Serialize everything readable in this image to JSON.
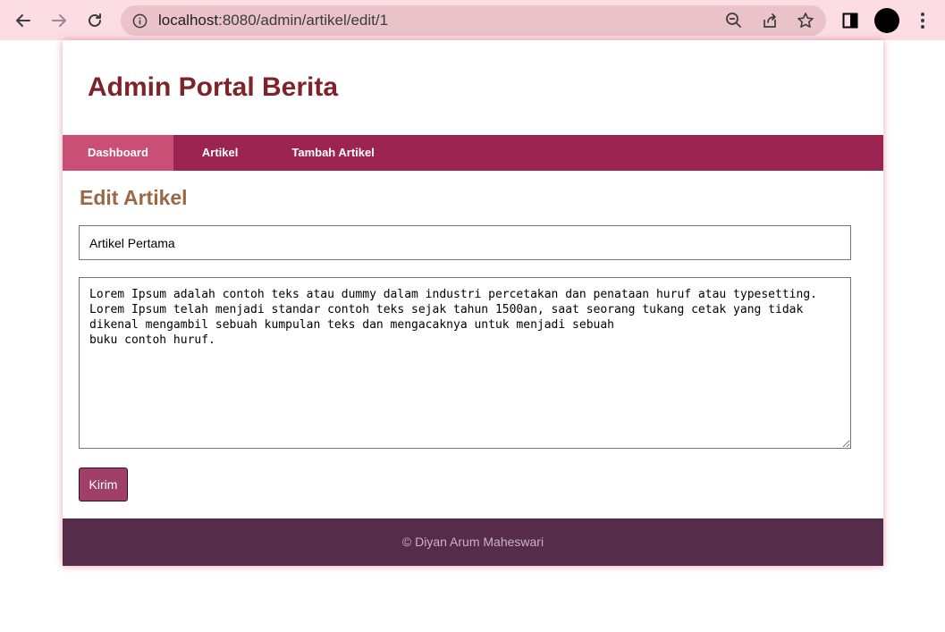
{
  "browser": {
    "url_host": "localhost",
    "url_rest": ":8080/admin/artikel/edit/1",
    "back_icon": "arrow-left-icon",
    "forward_icon": "arrow-right-icon",
    "reload_icon": "reload-icon",
    "info_icon": "info-icon",
    "zoom_icon": "zoom-out-icon",
    "share_icon": "share-icon",
    "star_icon": "star-icon",
    "sidepanel_icon": "side-panel-icon",
    "menu_icon": "kebab-menu-icon",
    "bar_color": "#fbdde3"
  },
  "site": {
    "title": "Admin Portal Berita",
    "title_color": "#7d2329",
    "menu_color": "#9b2550",
    "active_color": "#c94f76"
  },
  "nav": {
    "items": [
      {
        "label": "Dashboard",
        "active": true
      },
      {
        "label": "Artikel",
        "active": false
      },
      {
        "label": "Tambah Artikel",
        "active": false
      }
    ]
  },
  "form": {
    "heading": "Edit Artikel",
    "title_value": "Artikel Pertama",
    "body_value": "Lorem Ipsum adalah contoh teks atau dummy dalam industri percetakan dan penataan huruf atau typesetting. \nLorem Ipsum telah menjadi standar contoh teks sejak tahun 1500an, saat seorang tukang cetak yang tidak\ndikenal mengambil sebuah kumpulan teks dan mengacaknya untuk menjadi sebuah\nbuku contoh huruf.",
    "submit_label": "Kirim"
  },
  "footer": {
    "text": "© Diyan Arum Maheswari",
    "color": "#552c4a"
  }
}
